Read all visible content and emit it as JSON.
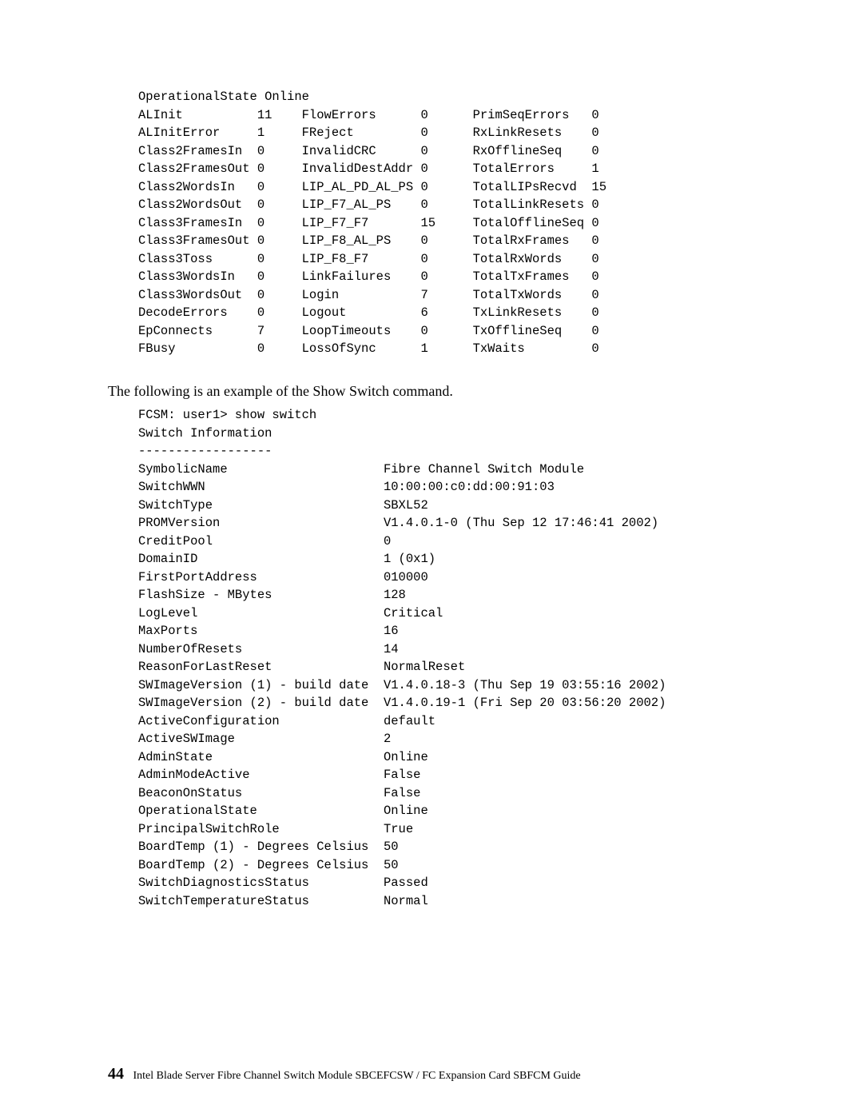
{
  "port_stats": {
    "col1": [
      [
        "ALInit",
        "11"
      ],
      [
        "ALInitError",
        "1"
      ],
      [
        "Class2FramesIn",
        "0"
      ],
      [
        "Class2FramesOut",
        "0"
      ],
      [
        "Class2WordsIn",
        "0"
      ],
      [
        "Class2WordsOut",
        "0"
      ],
      [
        "Class3FramesIn",
        "0"
      ],
      [
        "Class3FramesOut",
        "0"
      ],
      [
        "Class3Toss",
        "0"
      ],
      [
        "Class3WordsIn",
        "0"
      ],
      [
        "Class3WordsOut",
        "0"
      ],
      [
        "DecodeErrors",
        "0"
      ],
      [
        "EpConnects",
        "7"
      ],
      [
        "FBusy",
        "0"
      ]
    ],
    "col2": [
      [
        "FlowErrors",
        "0"
      ],
      [
        "FReject",
        "0"
      ],
      [
        "InvalidCRC",
        "0"
      ],
      [
        "InvalidDestAddr",
        "0"
      ],
      [
        "LIP_AL_PD_AL_PS",
        "0"
      ],
      [
        "LIP_F7_AL_PS",
        "0"
      ],
      [
        "LIP_F7_F7",
        "15"
      ],
      [
        "LIP_F8_AL_PS",
        "0"
      ],
      [
        "LIP_F8_F7",
        "0"
      ],
      [
        "LinkFailures",
        "0"
      ],
      [
        "Login",
        "7"
      ],
      [
        "Logout",
        "6"
      ],
      [
        "LoopTimeouts",
        "0"
      ],
      [
        "LossOfSync",
        "1"
      ]
    ],
    "col3": [
      [
        "PrimSeqErrors",
        "0"
      ],
      [
        "RxLinkResets",
        "0"
      ],
      [
        "RxOfflineSeq",
        "0"
      ],
      [
        "TotalErrors",
        "1"
      ],
      [
        "TotalLIPsRecvd",
        "15"
      ],
      [
        "TotalLinkResets",
        "0"
      ],
      [
        "TotalOfflineSeq",
        "0"
      ],
      [
        "TotalRxFrames",
        "0"
      ],
      [
        "TotalRxWords",
        "0"
      ],
      [
        "TotalTxFrames",
        "0"
      ],
      [
        "TotalTxWords",
        "0"
      ],
      [
        "TxLinkResets",
        "0"
      ],
      [
        "TxOfflineSeq",
        "0"
      ],
      [
        "TxWaits",
        "0"
      ]
    ],
    "header_line": "OperationalState Online"
  },
  "body_text": "The following is an example of the Show Switch command.",
  "cli": {
    "prompt": "FCSM: user1> show switch",
    "heading": "Switch Information",
    "divider": "------------------",
    "rows": [
      [
        "SymbolicName",
        "Fibre Channel Switch Module"
      ],
      [
        "SwitchWWN",
        "10:00:00:c0:dd:00:91:03"
      ],
      [
        "SwitchType",
        "SBXL52"
      ],
      [
        "PROMVersion",
        "V1.4.0.1-0 (Thu Sep 12 17:46:41 2002)"
      ],
      [
        "CreditPool",
        "0"
      ],
      [
        "DomainID",
        "1 (0x1)"
      ],
      [
        "FirstPortAddress",
        "010000"
      ],
      [
        "FlashSize - MBytes",
        "128"
      ],
      [
        "LogLevel",
        "Critical"
      ],
      [
        "MaxPorts",
        "16"
      ],
      [
        "NumberOfResets",
        "14"
      ],
      [
        "ReasonForLastReset",
        "NormalReset"
      ],
      [
        "SWImageVersion (1) - build date",
        "V1.4.0.18-3 (Thu Sep 19 03:55:16 2002)"
      ],
      [
        "SWImageVersion (2) - build date",
        "V1.4.0.19-1 (Fri Sep 20 03:56:20 2002)"
      ],
      [
        "ActiveConfiguration",
        "default"
      ],
      [
        "ActiveSWImage",
        "2"
      ],
      [
        "AdminState",
        "Online"
      ],
      [
        "AdminModeActive",
        "False"
      ],
      [
        "BeaconOnStatus",
        "False"
      ],
      [
        "OperationalState",
        "Online"
      ],
      [
        "PrincipalSwitchRole",
        "True"
      ],
      [
        "BoardTemp (1) - Degrees Celsius",
        "50"
      ],
      [
        "BoardTemp (2) - Degrees Celsius",
        "50"
      ],
      [
        "SwitchDiagnosticsStatus",
        "Passed"
      ],
      [
        "SwitchTemperatureStatus",
        "Normal"
      ]
    ]
  },
  "footer": {
    "page_number": "44",
    "title": "Intel Blade Server Fibre Channel Switch Module SBCEFCSW / FC Expansion Card SBFCM Guide"
  }
}
